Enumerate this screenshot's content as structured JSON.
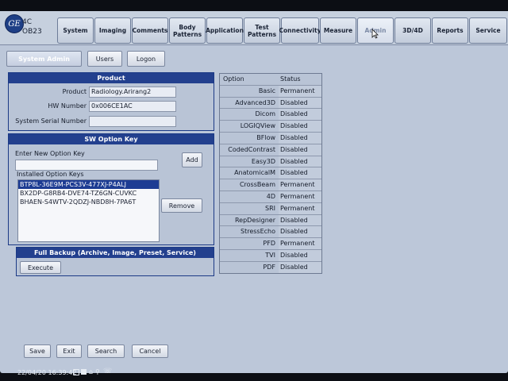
{
  "header": {
    "probe": "4C",
    "preset": "OB23",
    "logo_text": "GE",
    "tabs": [
      {
        "label": "System"
      },
      {
        "label": "Imaging"
      },
      {
        "label": "Comments"
      },
      {
        "label": "Body\nPatterns"
      },
      {
        "label": "Application"
      },
      {
        "label": "Test\nPatterns"
      },
      {
        "label": "Connectivity"
      },
      {
        "label": "Measure"
      },
      {
        "label": "Admin"
      },
      {
        "label": "3D/4D"
      },
      {
        "label": "Reports"
      },
      {
        "label": "Service"
      }
    ],
    "active_tab": "Admin"
  },
  "subtabs": {
    "system_admin": "System Admin",
    "users": "Users",
    "logon": "Logon"
  },
  "product_panel": {
    "title": "Product",
    "product_label": "Product",
    "product_value": "Radiology.Arirang2",
    "hw_label": "HW Number",
    "hw_value": "0x006CE1AC",
    "serial_label": "System Serial Number",
    "serial_value": ""
  },
  "sw_panel": {
    "title": "SW Option Key",
    "enter_label": "Enter New Option Key",
    "enter_value": "",
    "add_label": "Add",
    "installed_label": "Installed Option Keys",
    "keys": [
      "BTP8L-36E9M-PCS3V-477XJ-P4ALJ",
      "BX2DP-G8RB4-DVE74-TZ6GN-CUVKC",
      "BHAEN-S4WTV-2QDZJ-NBD8H-7PA6T"
    ],
    "remove_label": "Remove"
  },
  "backup_panel": {
    "title": "Full Backup (Archive, Image, Preset, Service)",
    "execute_label": "Execute"
  },
  "options_table": {
    "headers": {
      "option": "Option",
      "status": "Status"
    },
    "rows": [
      {
        "option": "Basic",
        "status": "Permanent"
      },
      {
        "option": "Advanced3D",
        "status": "Disabled"
      },
      {
        "option": "Dicom",
        "status": "Disabled"
      },
      {
        "option": "LOGIQView",
        "status": "Disabled"
      },
      {
        "option": "BFlow",
        "status": "Disabled"
      },
      {
        "option": "CodedContrast",
        "status": "Disabled"
      },
      {
        "option": "Easy3D",
        "status": "Disabled"
      },
      {
        "option": "AnatomicalM",
        "status": "Disabled"
      },
      {
        "option": "CrossBeam",
        "status": "Permanent"
      },
      {
        "option": "4D",
        "status": "Permanent"
      },
      {
        "option": "SRI",
        "status": "Permanent"
      },
      {
        "option": "RepDesigner",
        "status": "Disabled"
      },
      {
        "option": "StressEcho",
        "status": "Disabled"
      },
      {
        "option": "PFD",
        "status": "Permanent"
      },
      {
        "option": "TVI",
        "status": "Disabled"
      },
      {
        "option": "PDF",
        "status": "Disabled"
      }
    ]
  },
  "bottom_buttons": {
    "save": "Save",
    "exit": "Exit",
    "search": "Search",
    "cancel": "Cancel"
  },
  "status_bar": {
    "datetime": "22/04/20 16:39:42"
  },
  "icons": {
    "logo": "ge-logo-icon",
    "cursor": "mouse-pointer-icon",
    "lock": "lock-icon",
    "drive": "disk-icon",
    "network": "network-icon",
    "usb": "usb-icon",
    "phone": "phone-icon"
  },
  "colors": {
    "panel_header": "#23408e",
    "selection": "#1d3c93",
    "background": "#bcc7d9"
  }
}
